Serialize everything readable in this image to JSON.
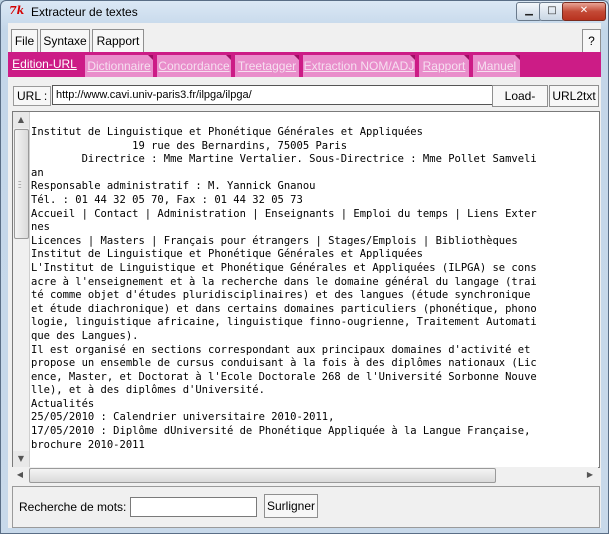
{
  "window": {
    "title": "Extracteur de textes",
    "icon": "7k",
    "controls": {
      "minimize": "▁",
      "maximize": "□",
      "close": "✕"
    }
  },
  "menu": {
    "file": "File",
    "syntax": "Syntaxe",
    "report": "Rapport",
    "help": "?"
  },
  "tabs": [
    {
      "label": "Edition-URL",
      "active": true
    },
    {
      "label": "Dictionnaire",
      "active": false
    },
    {
      "label": "Concordance",
      "active": false
    },
    {
      "label": "Treetagger",
      "active": false
    },
    {
      "label": "Extraction NOM/ADJ",
      "active": false
    },
    {
      "label": "Rapport",
      "active": false
    },
    {
      "label": "Manuel",
      "active": false
    }
  ],
  "url_bar": {
    "label": "URL :",
    "value": "http://www.cavi.univ-paris3.fr/ilpga/ilpga/",
    "load_button": "Load-URL",
    "url2txt_button": "URL2txt"
  },
  "content": {
    "lines": [
      "Institut de Linguistique et Phonétique Générales et Appliquées",
      "                19 rue des Bernardins, 75005 Paris",
      "        Directrice : Mme Martine Vertalier. Sous-Directrice : Mme Pollet Samveli",
      "an",
      "Responsable administratif : M. Yannick Gnanou",
      "Tél. : 01 44 32 05 70, Fax : 01 44 32 05 73",
      "Accueil | Contact | Administration | Enseignants | Emploi du temps | Liens Exter",
      "nes",
      "Licences | Masters | Français pour étrangers | Stages/Emplois | Bibliothèques",
      "Institut de Linguistique et Phonétique Générales et Appliquées",
      "L'Institut de Linguistique et Phonétique Générales et Appliquées (ILPGA) se cons",
      "acre à l'enseignement et à la recherche dans le domaine général du langage (trai",
      "té comme objet d'études pluridisciplinaires) et des langues (étude synchronique",
      "et étude diachronique) et dans certains domaines particuliers (phonétique, phono",
      "logie, linguistique africaine, linguistique finno-ougrienne, Traitement Automati",
      "que des Langues).",
      "Il est organisé en sections correspondant aux principaux domaines d'activité et",
      "propose un ensemble de cursus conduisant à la fois à des diplômes nationaux (Lic",
      "ence, Master, et Doctorat à l'Ecole Doctorale 268 de l'Université Sorbonne Nouve",
      "lle), et à des diplômes d'Université.",
      "Actualités",
      "25/05/2010 : Calendrier universitaire 2010-2011,",
      "17/05/2010 : Diplôme dUniversité de Phonétique Appliquée à la Langue Française,",
      "brochure 2010-2011"
    ]
  },
  "search": {
    "label": "Recherche de mots:",
    "value": "",
    "button": "Surligner"
  },
  "colors": {
    "tab_bar": "#cc1c86",
    "tab_inactive": "#e98dcb",
    "titlebar": "#c3d6e9"
  }
}
